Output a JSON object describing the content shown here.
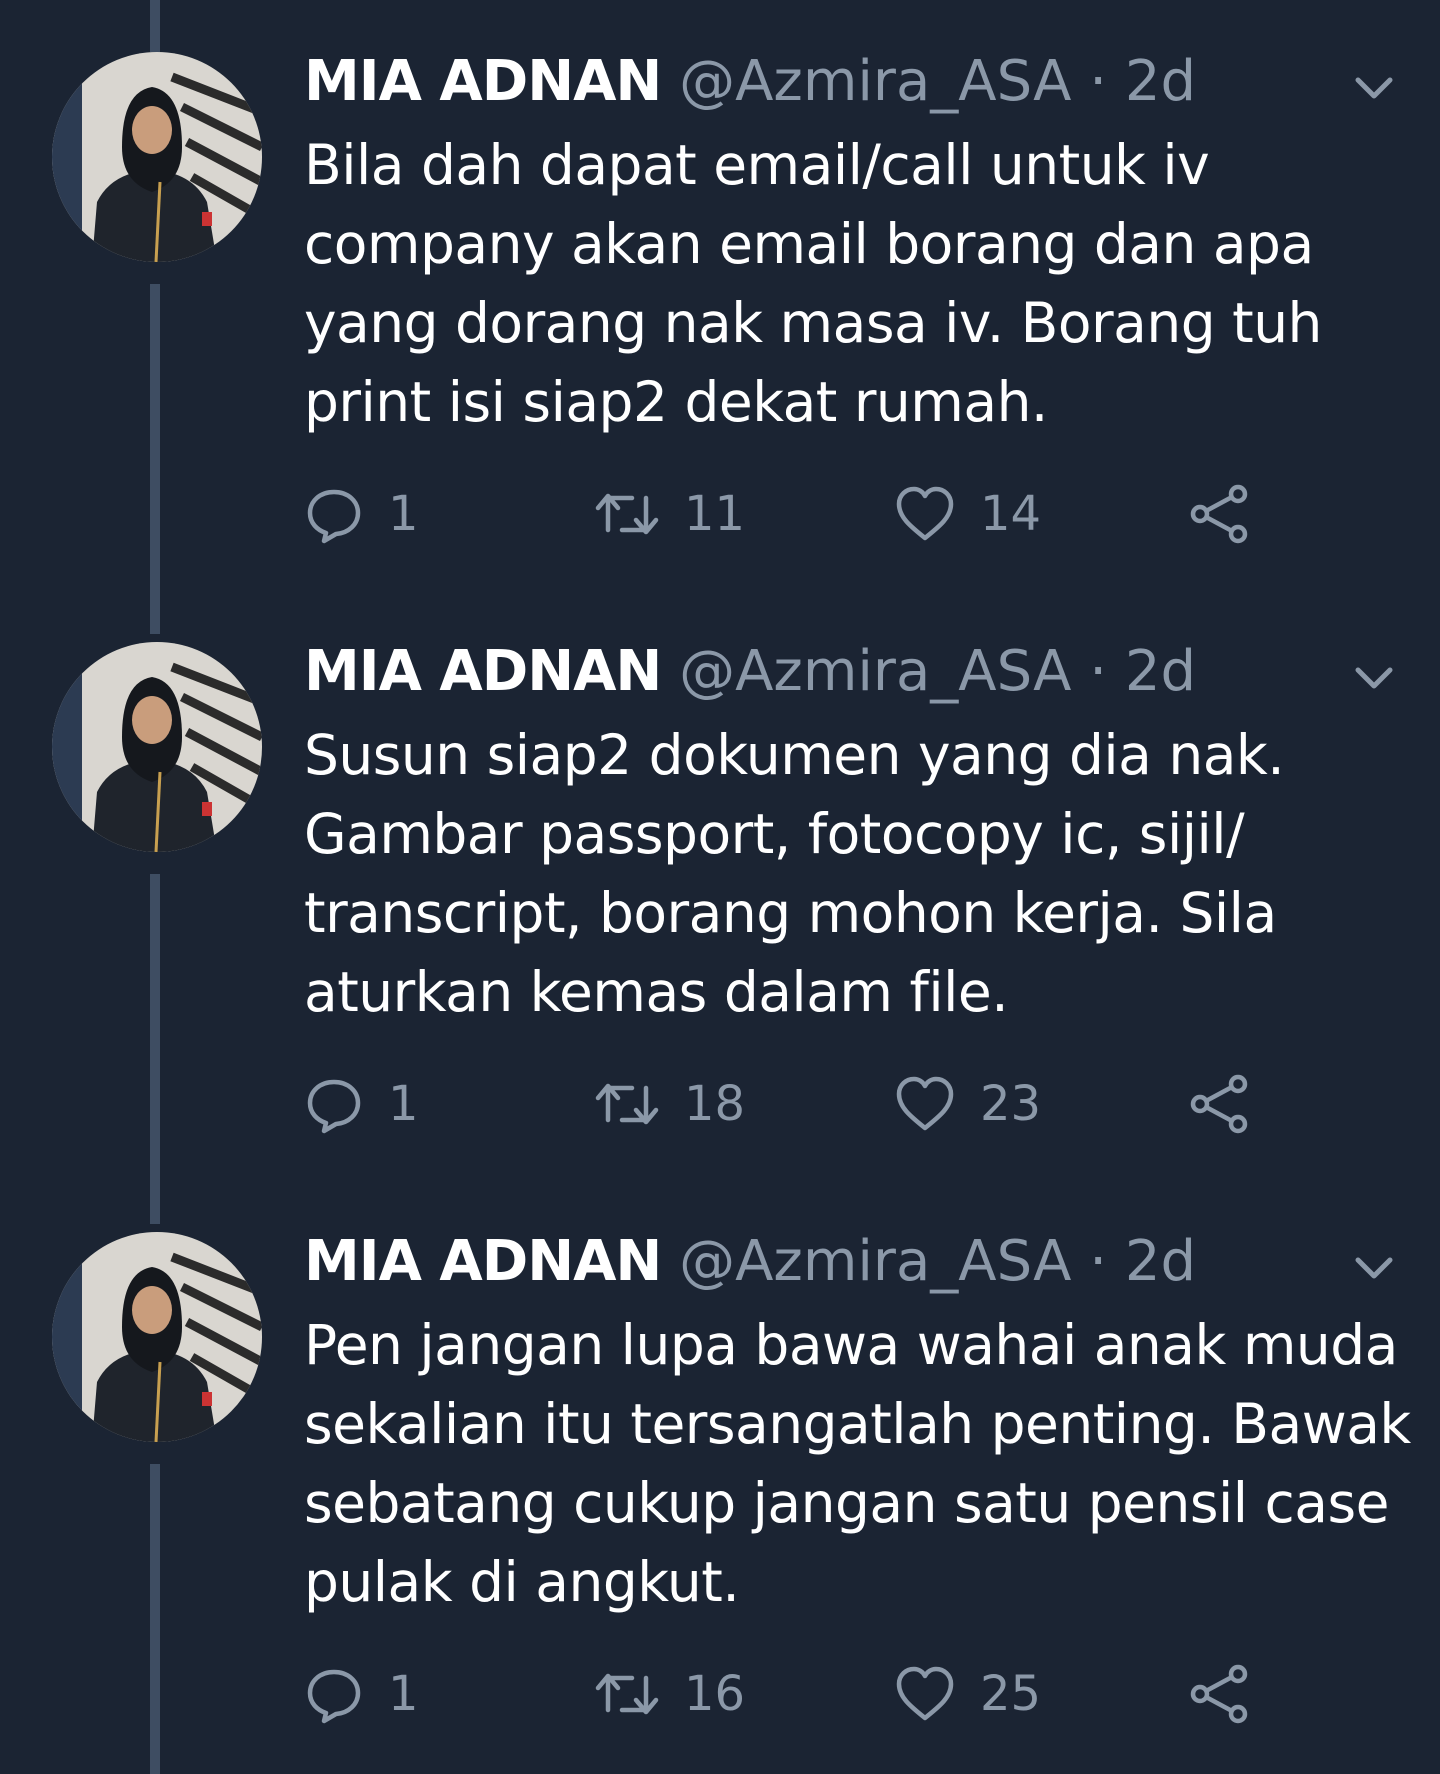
{
  "theme": {
    "background": "#1b2433",
    "thread_line": "#3e4d62",
    "secondary_text": "#8b98a8",
    "primary_text": "#ffffff"
  },
  "tweets": [
    {
      "name": "MIA ADNAN",
      "handle": "@Azmira_ASA",
      "separator": "·",
      "time": "2d",
      "text": "Bila dah dapat email/call untuk iv\ncompany akan email borang dan apa\nyang dorang nak masa iv. Borang tuh\nprint isi siap2 dekat rumah.",
      "replies": "1",
      "retweets": "11",
      "likes": "14"
    },
    {
      "name": "MIA ADNAN",
      "handle": "@Azmira_ASA",
      "separator": "·",
      "time": "2d",
      "text": "Susun siap2 dokumen yang dia nak.\nGambar passport,  fotocopy ic, sijil/\ntranscript, borang mohon kerja.  Sila\naturkan kemas dalam file.",
      "replies": "1",
      "retweets": "18",
      "likes": "23"
    },
    {
      "name": "MIA ADNAN",
      "handle": "@Azmira_ASA",
      "separator": "·",
      "time": "2d",
      "text": "Pen jangan lupa bawa wahai anak muda\nsekalian itu tersangatlah penting. Bawak\nsebatang cukup jangan satu pensil case\npulak di angkut.",
      "replies": "1",
      "retweets": "16",
      "likes": "25"
    }
  ],
  "icons": {
    "reply": "speech-bubble",
    "retweet": "retweet-arrows",
    "like": "heart",
    "share": "share-nodes",
    "menu": "chevron-down",
    "avatar": "profile-photo"
  }
}
